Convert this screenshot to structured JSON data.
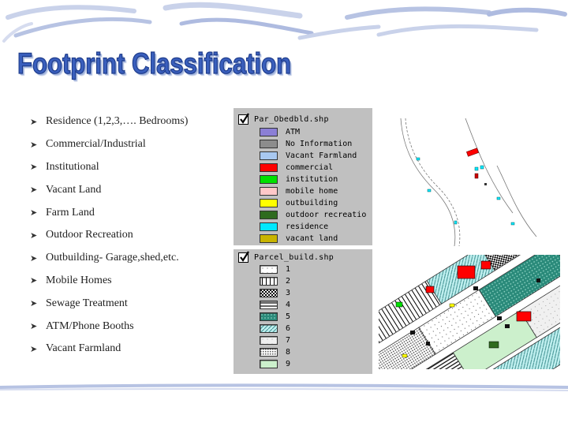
{
  "slide": {
    "title": "Footprint Classification",
    "bullets": [
      "Residence (1,2,3,…. Bedrooms)",
      "Commercial/Industrial",
      "Institutional",
      "Vacant Land",
      "Farm Land",
      "Outdoor Recreation",
      "Outbuilding- Garage,shed,etc.",
      "Mobile Homes",
      "Sewage Treatment",
      "ATM/Phone Booths",
      "Vacant Farmland"
    ]
  },
  "legend1": {
    "layer": "Par_Obedbld.shp",
    "items": [
      {
        "label": "ATM",
        "color": "#8b7fd6"
      },
      {
        "label": "No Information",
        "color": "#8c8c8c"
      },
      {
        "label": "Vacant Farmland",
        "color": "#a8c8f0"
      },
      {
        "label": "commercial",
        "color": "#ff0000"
      },
      {
        "label": "institution",
        "color": "#00e000"
      },
      {
        "label": "mobile home",
        "color": "#ffc8c8"
      },
      {
        "label": "outbuilding",
        "color": "#ffff00"
      },
      {
        "label": "outdoor recreatio",
        "color": "#2f6b1f"
      },
      {
        "label": "residence",
        "color": "#00e8ff"
      },
      {
        "label": "vacant land",
        "color": "#c8b400"
      }
    ]
  },
  "legend2": {
    "layer": "Parcel_build.shp",
    "items": [
      {
        "label": "1",
        "pattern": "p1"
      },
      {
        "label": "2",
        "pattern": "p2"
      },
      {
        "label": "3",
        "pattern": "p3"
      },
      {
        "label": "4",
        "pattern": "p4"
      },
      {
        "label": "5",
        "pattern": "p5"
      },
      {
        "label": "6",
        "pattern": "p6"
      },
      {
        "label": "7",
        "pattern": "p7"
      },
      {
        "label": "8",
        "pattern": "p8"
      },
      {
        "label": "9",
        "pattern": "p9"
      }
    ]
  }
}
